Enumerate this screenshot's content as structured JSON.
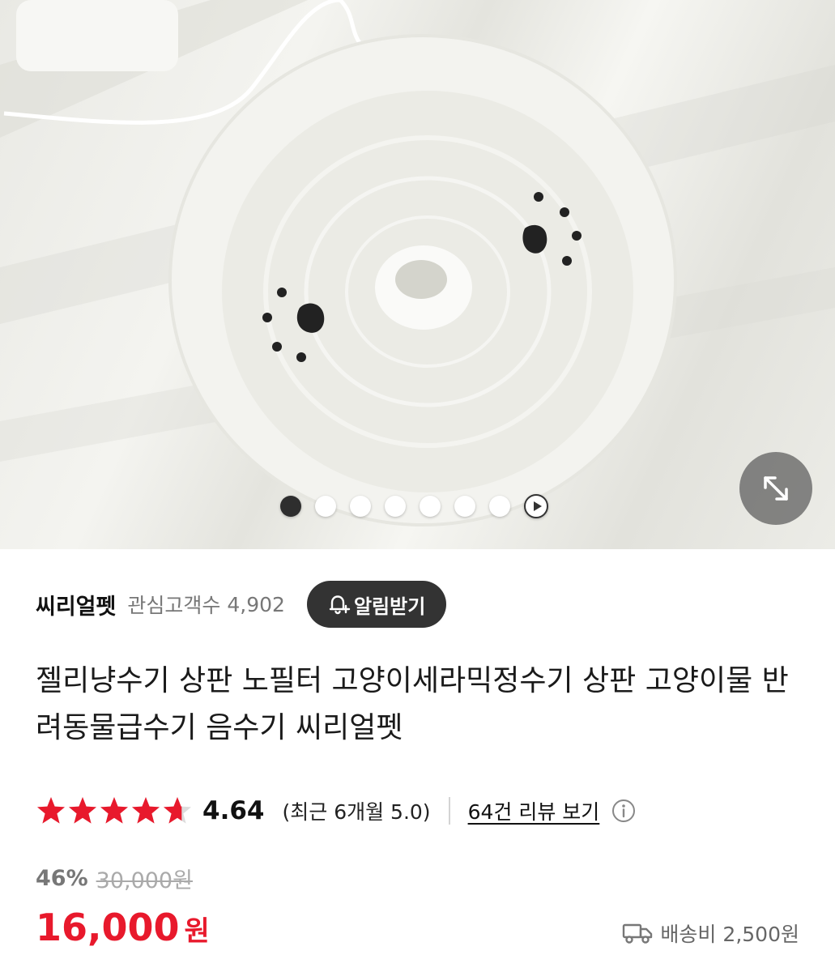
{
  "hero": {
    "image_icon": "water-fountain-photo",
    "slide_count": 7,
    "active_slide": 1,
    "play_icon": "play-icon",
    "expand_icon": "expand-arrows-icon"
  },
  "seller": {
    "name": "씨리얼펫",
    "follower_label": "관심고객수",
    "follower_count": "4,902",
    "alarm_label": "알림받기",
    "alarm_icon": "bell-plus-icon"
  },
  "product": {
    "title": "젤리냥수기 상판 노필터 고양이세라믹정수기 상판 고양이물 반려동물급수기 음수기 씨리얼펫"
  },
  "rating": {
    "stars": 4.64,
    "score": "4.64",
    "recent": "(최근 6개월 5.0)",
    "review_link": "64건 리뷰 보기",
    "info_icon": "info-icon",
    "star_color": "#e8192c"
  },
  "price": {
    "discount_rate": "46%",
    "original": "30,000원",
    "sale": "16,000",
    "currency": "원",
    "accent_color": "#e8192c"
  },
  "shipping": {
    "icon": "truck-icon",
    "label": "배송비",
    "fee": "2,500원"
  }
}
